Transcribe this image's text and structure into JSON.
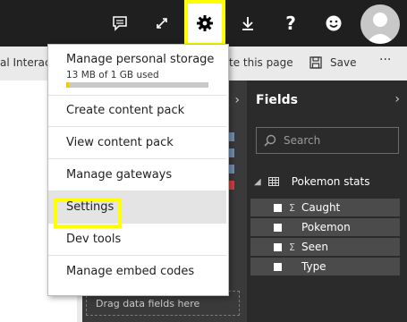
{
  "topbar": {
    "buttons": [
      "comment",
      "expand",
      "settings",
      "download",
      "help",
      "feedback"
    ],
    "help_label": "?",
    "settings_highlight_color": "#ffff00"
  },
  "toolbar": {
    "left_text": "al Interacti",
    "middle_text": "te this page",
    "save_label": "Save",
    "more_label": "···"
  },
  "menu": {
    "storage": {
      "title": "Manage personal storage",
      "usage": "13 MB of 1 GB used",
      "used_fraction": 0.013
    },
    "items": [
      "Create content pack",
      "View content pack",
      "Manage gateways",
      "Settings",
      "Dev tools",
      "Manage embed codes"
    ],
    "highlighted": "Settings"
  },
  "fields_pane": {
    "title": "Fields",
    "search_placeholder": "Search",
    "table_name": "Pokemon stats",
    "fields": [
      {
        "name": "Caught",
        "sigma": "Σ"
      },
      {
        "name": "Pokemon",
        "sigma": ""
      },
      {
        "name": "Seen",
        "sigma": "Σ"
      },
      {
        "name": "Type",
        "sigma": ""
      }
    ]
  },
  "viz_pane": {
    "drag_text": "Drag data fields here"
  },
  "colors": {
    "topbar": "#1f1f1f",
    "highlight": "#ffff00",
    "storage_bar": "#f2c80f",
    "fields_bg": "#2b2b2b"
  }
}
